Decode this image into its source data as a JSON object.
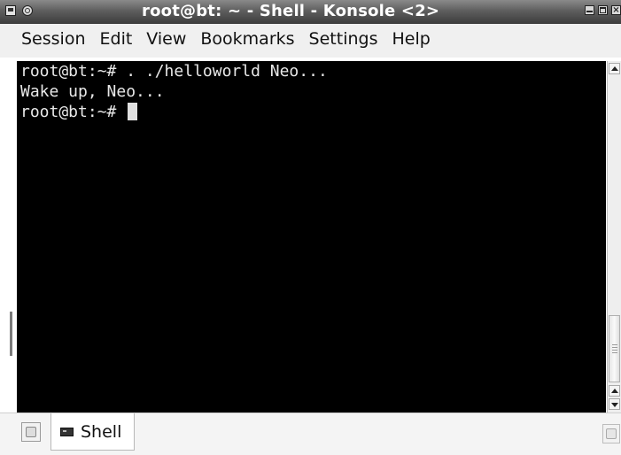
{
  "window": {
    "title": "root@bt: ~ - Shell - Konsole <2>"
  },
  "menubar": {
    "items": [
      "Session",
      "Edit",
      "View",
      "Bookmarks",
      "Settings",
      "Help"
    ]
  },
  "terminal": {
    "lines": [
      "root@bt:~# . ./helloworld Neo...",
      "Wake up, Neo...",
      "root@bt:~# "
    ]
  },
  "tabs": [
    {
      "label": "Shell",
      "icon": "terminal-icon",
      "active": true
    }
  ],
  "icons": {
    "window_menu": "app-menu-icon",
    "sticky": "sticky-icon",
    "minimize": "minimize-icon",
    "maximize": "maximize-icon",
    "close": "close-icon",
    "new_tab": "new-tab-icon",
    "close_tab": "close-tab-icon"
  },
  "colors": {
    "terminal_bg": "#000000",
    "terminal_fg": "#e8e8e8",
    "titlebar": "#5e5e5e"
  }
}
